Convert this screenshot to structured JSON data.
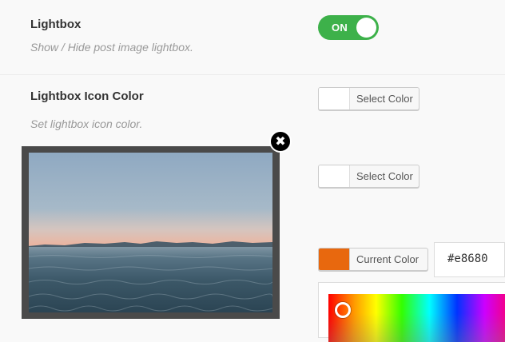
{
  "settings": {
    "lightbox": {
      "title": "Lightbox",
      "description": "Show / Hide post image lightbox.",
      "toggle_label": "ON"
    },
    "lightbox_icon_color": {
      "title": "Lightbox Icon Color",
      "description": "Set lightbox icon color."
    }
  },
  "color_buttons": {
    "first_label": "Select Color",
    "second_label": "Select Color",
    "current_label": "Current Color"
  },
  "color_picker": {
    "hex_value": "#e8680",
    "current_swatch_color": "#e8680e"
  },
  "lightbox_overlay": {
    "close_icon": "close-icon",
    "close_glyph": "✖"
  },
  "colors": {
    "toggle_on": "#3db14a",
    "overlay_frame": "#4a4a4a"
  }
}
